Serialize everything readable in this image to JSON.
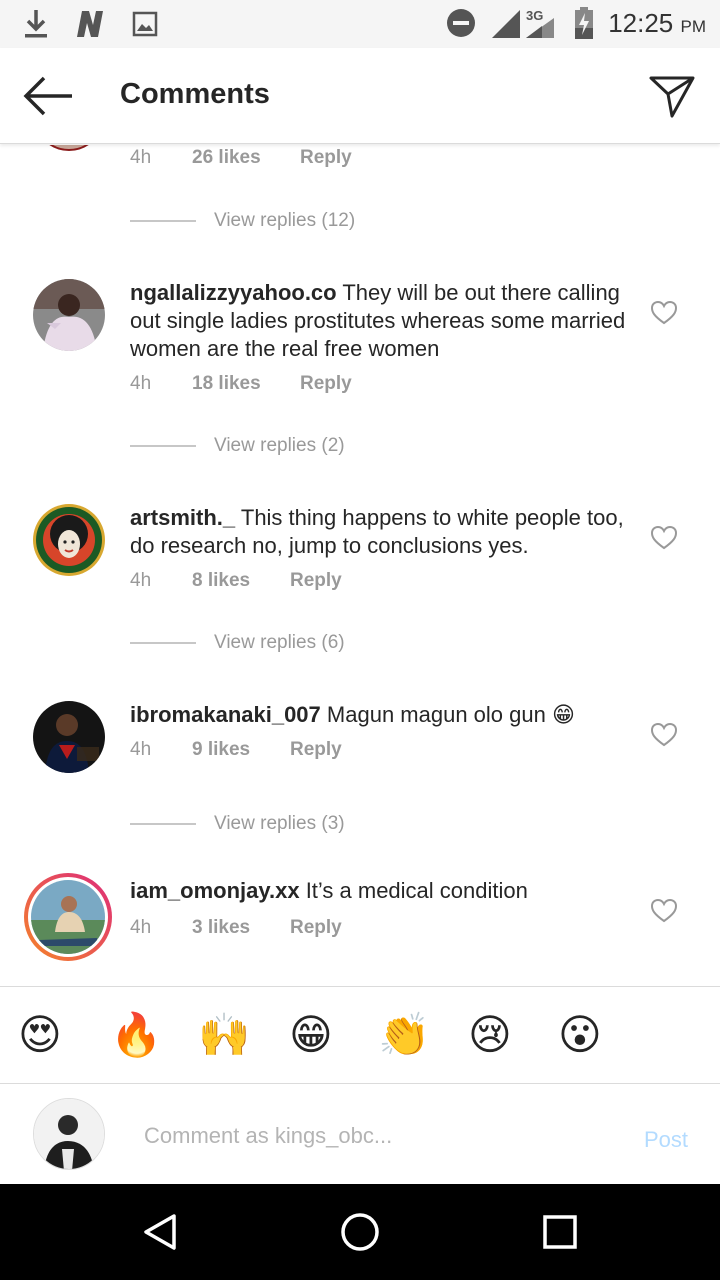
{
  "status_bar": {
    "time": "12:25",
    "ampm": "PM",
    "network": "3G",
    "icons": [
      "download-icon",
      "n-notification-icon",
      "image-icon",
      "do-not-disturb-icon",
      "signal-icon",
      "battery-charging-icon"
    ]
  },
  "header": {
    "title": "Comments",
    "back_icon": "arrow-left-icon",
    "share_icon": "send-icon"
  },
  "top_partial": {
    "time": "4h",
    "likes": "26 likes",
    "reply": "Reply",
    "view_replies": "View replies (12)"
  },
  "comments": [
    {
      "username": "ngallalizzyyahoo.co",
      "text": "They will be out there calling out single ladies prostitutes whereas some married women are the real free women",
      "time": "4h",
      "likes": "18 likes",
      "reply": "Reply",
      "view_replies": "View replies (2)"
    },
    {
      "username": "artsmith._",
      "text": "This thing happens to white people too, do research no, jump to conclusions yes.",
      "time": "4h",
      "likes": "8 likes",
      "reply": "Reply",
      "view_replies": "View replies (6)"
    },
    {
      "username": "ibromakanaki_007",
      "text": "Magun magun olo gun 😁",
      "time": "4h",
      "likes": "9 likes",
      "reply": "Reply",
      "view_replies": "View replies (3)"
    },
    {
      "username": "iam_omonjay.xx",
      "text": "It’s a medical condition",
      "time": "4h",
      "likes": "3 likes",
      "reply": "Reply"
    }
  ],
  "emoji_bar": [
    "😍",
    "🔥",
    "🙌",
    "😁",
    "👏",
    "😢",
    "😮"
  ],
  "composer": {
    "placeholder": "Comment as kings_obc...",
    "post_label": "Post"
  },
  "colors": {
    "meta_gray": "#999999",
    "post_disabled": "#b3dbff",
    "story_ring_start": "#f58529",
    "story_ring_end": "#dd2a7b"
  }
}
